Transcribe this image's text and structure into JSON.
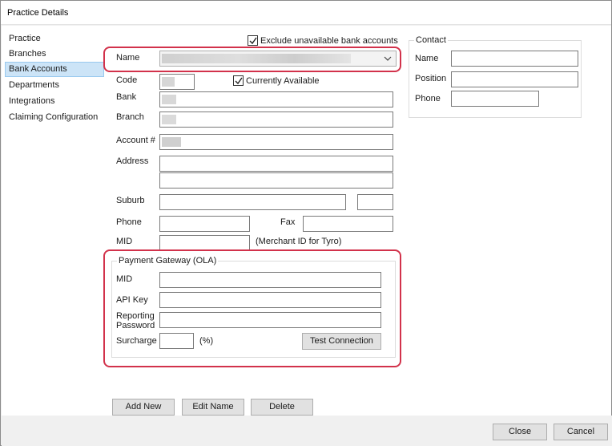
{
  "window": {
    "title": "Practice Details"
  },
  "sidebar": {
    "items": [
      {
        "label": "Practice"
      },
      {
        "label": "Branches"
      },
      {
        "label": "Bank Accounts"
      },
      {
        "label": "Departments"
      },
      {
        "label": "Integrations"
      },
      {
        "label": "Claiming Configuration"
      }
    ],
    "selected": "Bank Accounts"
  },
  "bank": {
    "exclude_unavailable_label": "Exclude unavailable bank accounts",
    "exclude_unavailable_checked": true,
    "name_label": "Name",
    "code_label": "Code",
    "currently_available_label": "Currently Available",
    "currently_available_checked": true,
    "bank_label": "Bank",
    "branch_label": "Branch",
    "account_label": "Account #",
    "address_label": "Address",
    "suburb_label": "Suburb",
    "phone_label": "Phone",
    "fax_label": "Fax",
    "mid_label": "MID",
    "mid_hint": "(Merchant ID for Tyro)"
  },
  "contact": {
    "group_title": "Contact",
    "name_label": "Name",
    "position_label": "Position",
    "phone_label": "Phone"
  },
  "gateway": {
    "group_title": "Payment Gateway (OLA)",
    "mid_label": "MID",
    "api_key_label": "API Key",
    "reporting_password_label_line1": "Reporting",
    "reporting_password_label_line2": "Password",
    "surcharge_label": "Surcharge",
    "surcharge_unit": "(%)",
    "test_connection_label": "Test Connection"
  },
  "actions": {
    "add_new": "Add New",
    "edit_name": "Edit Name",
    "delete": "Delete"
  },
  "footer": {
    "close": "Close",
    "cancel": "Cancel"
  },
  "colors": {
    "highlight": "#d2324b",
    "selection": "#cce4f7"
  }
}
